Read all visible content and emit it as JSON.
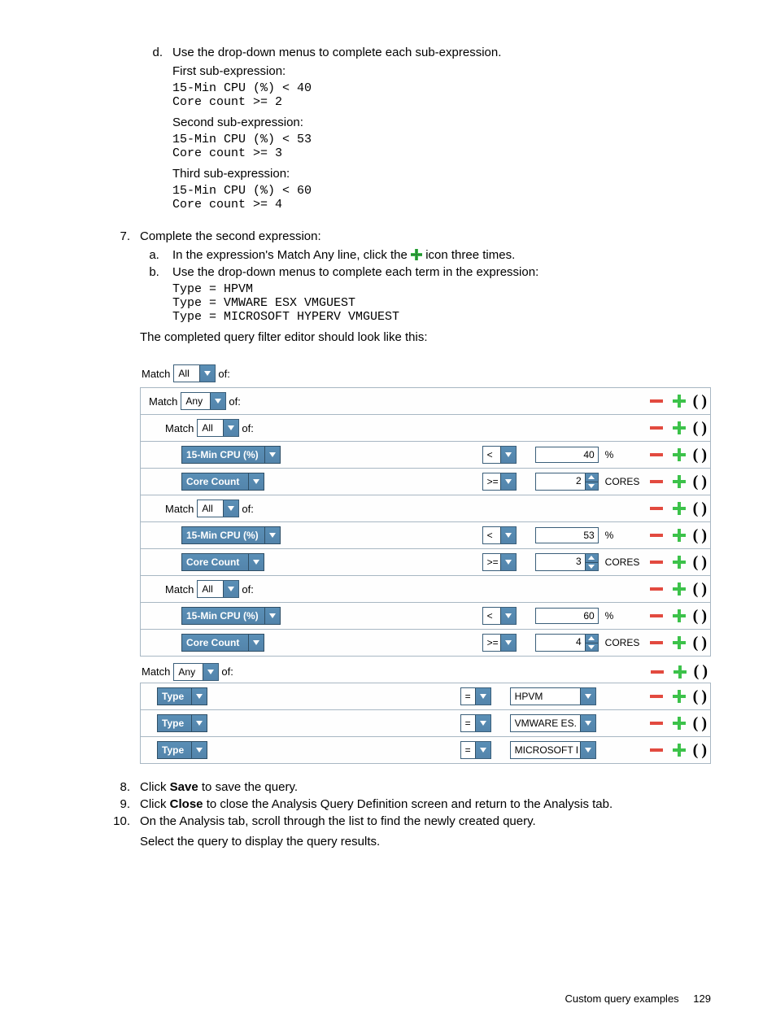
{
  "topSubList": {
    "startMarker": "d.",
    "intro": "Use the drop-down menus to complete each sub-expression.",
    "blocks": [
      {
        "label": "First sub-expression:",
        "code": "15-Min CPU (%) < 40\nCore count >= 2"
      },
      {
        "label": "Second sub-expression:",
        "code": "15-Min CPU (%) < 53\nCore count >= 3"
      },
      {
        "label": "Third sub-expression:",
        "code": "15-Min CPU (%) < 60\nCore count >= 4"
      }
    ]
  },
  "step7": {
    "num": "7.",
    "text": "Complete the second expression:",
    "a": {
      "pre": "In the expression's Match Any line, click the ",
      "post": " icon three times."
    },
    "b": "Use the drop-down menus to complete each term in the expression:",
    "code": "Type = HPVM\nType = VMWARE ESX VMGUEST\nType = MICROSOFT HYPERV VMGUEST",
    "tail": "The completed query filter editor should look like this:"
  },
  "editor": {
    "matchLabel": "Match",
    "ofLabel": "of:",
    "allValue": "All",
    "anyValue": "Any",
    "group1": {
      "sub1_cpu": {
        "metric": "15-Min CPU (%)",
        "op": "<",
        "val": "40",
        "unit": "%"
      },
      "sub1_core": {
        "metric": "Core Count",
        "op": ">=",
        "val": "2",
        "unit": "CORES"
      },
      "sub2_cpu": {
        "metric": "15-Min CPU (%)",
        "op": "<",
        "val": "53",
        "unit": "%"
      },
      "sub2_core": {
        "metric": "Core Count",
        "op": ">=",
        "val": "3",
        "unit": "CORES"
      },
      "sub3_cpu": {
        "metric": "15-Min CPU (%)",
        "op": "<",
        "val": "60",
        "unit": "%"
      },
      "sub3_core": {
        "metric": "Core Count",
        "op": ">=",
        "val": "4",
        "unit": "CORES"
      }
    },
    "group2": {
      "t1": {
        "metric": "Type",
        "op": "=",
        "val": "HPVM"
      },
      "t2": {
        "metric": "Type",
        "op": "=",
        "val": "VMWARE ES."
      },
      "t3": {
        "metric": "Type",
        "op": "=",
        "val": "MICROSOFT I"
      }
    }
  },
  "step8": {
    "num": "8.",
    "pre": "Click ",
    "bold": "Save",
    "post": " to save the query."
  },
  "step9": {
    "num": "9.",
    "pre": "Click ",
    "bold": "Close",
    "post": " to close the Analysis Query Definition screen and return to the Analysis tab."
  },
  "step10": {
    "num": "10.",
    "line1": "On the Analysis tab, scroll through the list to find the newly created query.",
    "line2": "Select the query to display the query results."
  },
  "footer": {
    "text": "Custom query examples",
    "page": "129"
  }
}
